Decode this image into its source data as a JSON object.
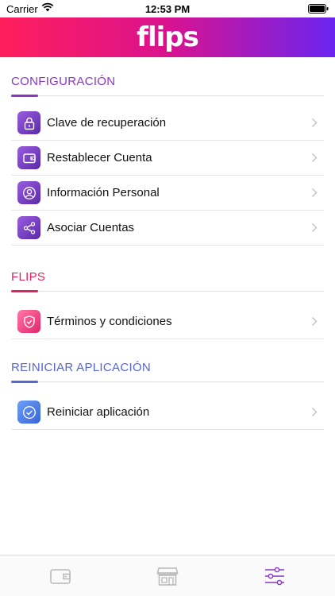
{
  "status_bar": {
    "carrier": "Carrier",
    "time": "12:53 PM",
    "icons": [
      "wifi-icon",
      "battery-icon"
    ]
  },
  "header": {
    "logo_text": "flips",
    "gradient": [
      "#ff1e5a",
      "#d9128f",
      "#6a24f0"
    ]
  },
  "sections": [
    {
      "title": "CONFIGURACIÓN",
      "color": "#8a35c9",
      "items": [
        {
          "label": "Clave de recuperación",
          "icon": "lock-icon"
        },
        {
          "label": "Restablecer Cuenta",
          "icon": "wallet-icon"
        },
        {
          "label": "Información Personal",
          "icon": "user-icon"
        },
        {
          "label": "Asociar Cuentas",
          "icon": "share-icon"
        }
      ]
    },
    {
      "title": "FLIPS",
      "color": "#e0245e",
      "items": [
        {
          "label": "Términos y condiciones",
          "icon": "shield-icon"
        }
      ]
    },
    {
      "title": "REINICIAR APLICACIÓN",
      "color": "#5566d6",
      "items": [
        {
          "label": "Reiniciar aplicación",
          "icon": "checkmark-circle-icon"
        }
      ]
    }
  ],
  "tab_bar": {
    "tabs": [
      {
        "icon": "wallet-tab-icon",
        "active": false
      },
      {
        "icon": "store-tab-icon",
        "active": false
      },
      {
        "icon": "settings-sliders-tab-icon",
        "active": true
      }
    ],
    "active_color": "#8a35c9",
    "inactive_color": "#b8b8b8"
  }
}
